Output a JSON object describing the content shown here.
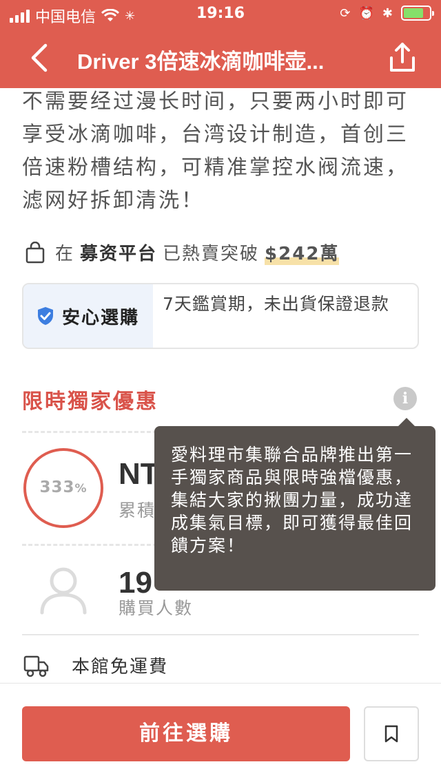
{
  "status_bar": {
    "carrier": "中国电信",
    "time": "19:16"
  },
  "nav": {
    "title": "Driver 3倍速冰滴咖啡壶...",
    "back_icon": "chevron-left-icon",
    "share_icon": "share-icon"
  },
  "description": "不需要经过漫长时间，只要两小时即可享受冰滴咖啡，台湾设计制造，首创三倍速粉槽结构，可精准掌控水阀流速，滤网好拆卸清洗！",
  "raised": {
    "prefix": "在",
    "platform": "募资平台",
    "middle": "已熱賣突破",
    "amount": "$242萬"
  },
  "guarantee": {
    "label": "安心選購",
    "text": "7天鑑賞期，未出貨保證退款"
  },
  "promo": {
    "title": "限時獨家優惠"
  },
  "stats": {
    "percent": "333",
    "percent_sign": "%",
    "amount_visible": "NT",
    "amount_label_visible": "累積",
    "buyers_visible": "19",
    "buyers_label": "購買人數"
  },
  "shipping": {
    "label": "本館免運費"
  },
  "tooltip": {
    "text": "愛料理市集聯合品牌推出第一手獨家商品與限時強檔優惠，集結大家的揪團力量，成功達成集氣目標，即可獲得最佳回饋方案！"
  },
  "actions": {
    "buy_label": "前往選購",
    "bookmark_icon": "bookmark-icon"
  },
  "colors": {
    "brand": "#df5d50",
    "tooltip_bg": "#57514d",
    "guarantee_bg": "#eef3fb",
    "shield": "#3d7ee0"
  }
}
